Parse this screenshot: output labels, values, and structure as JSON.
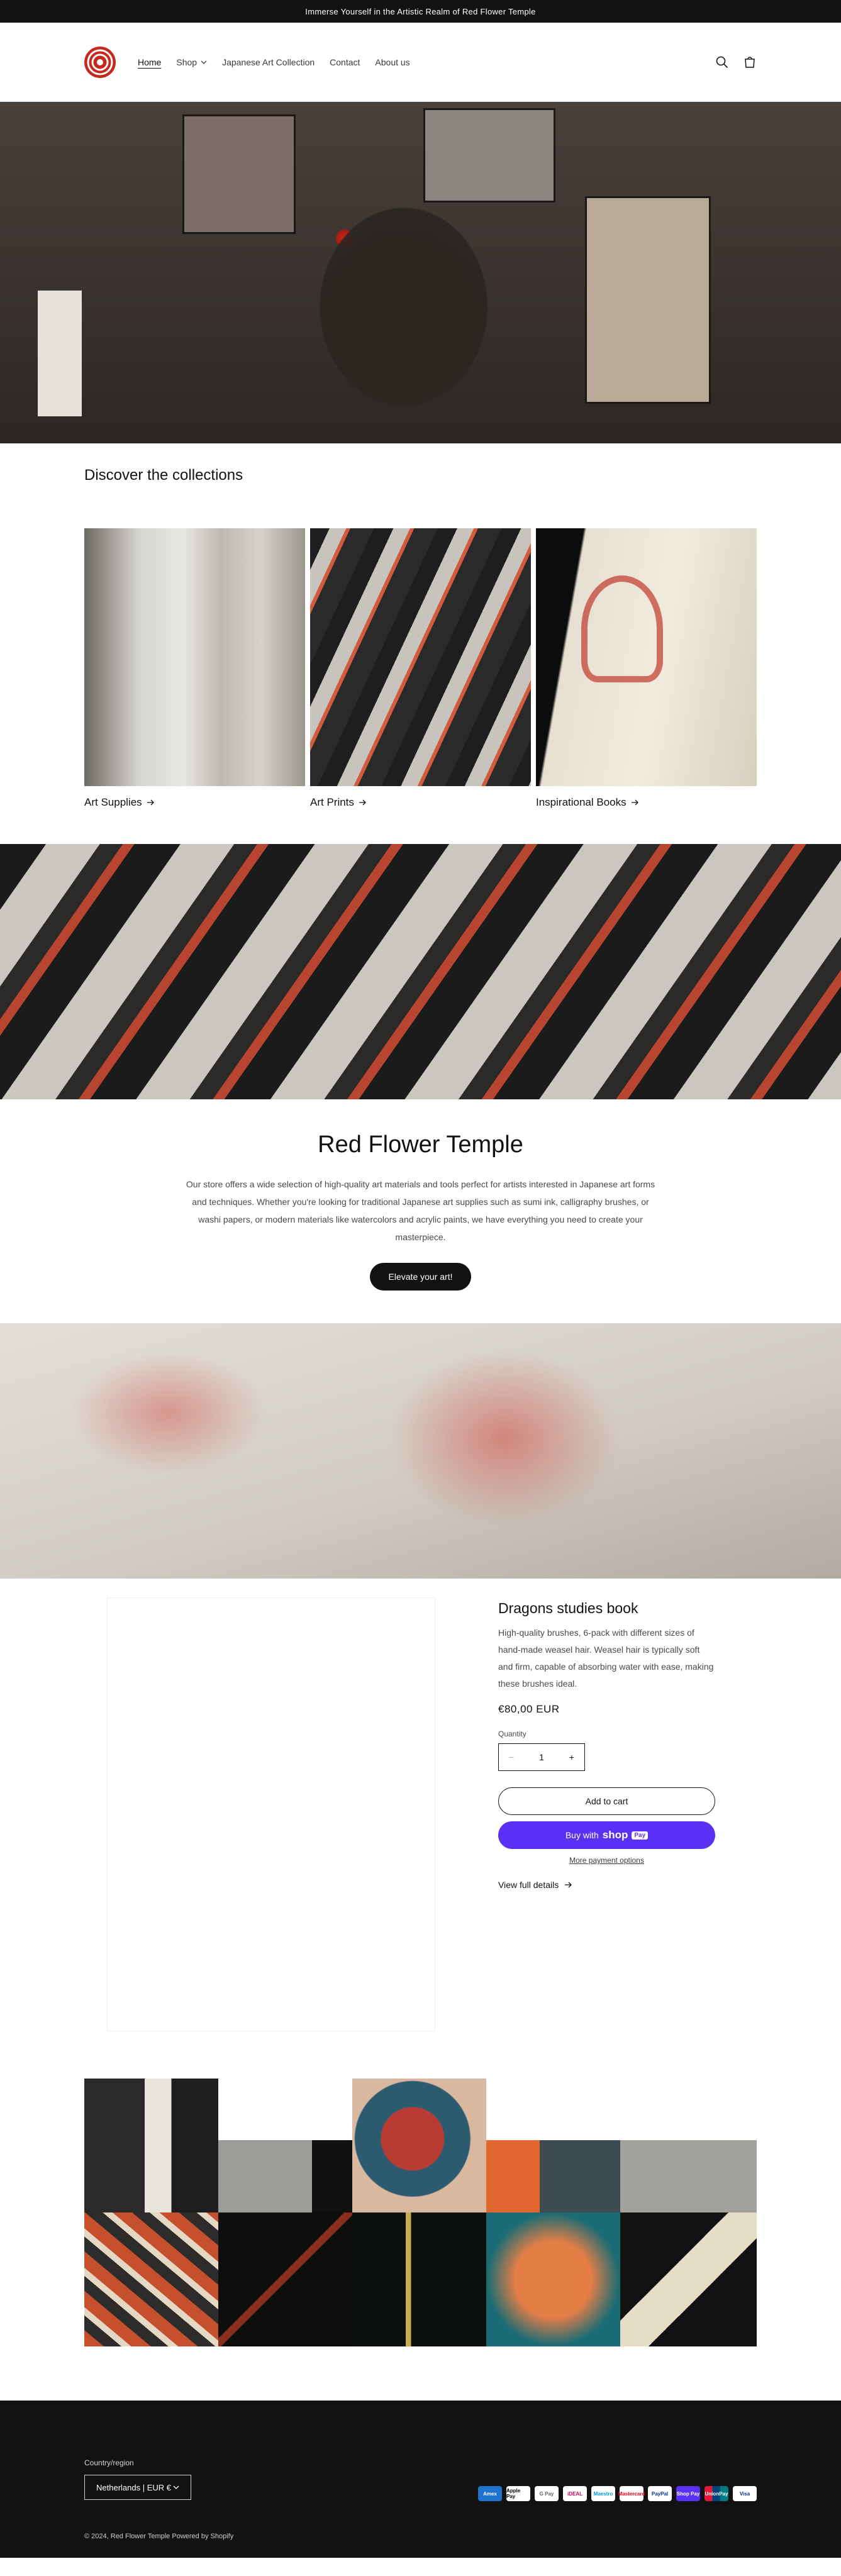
{
  "announcement": "Immerse Yourself in the Artistic Realm of Red Flower Temple",
  "header": {
    "nav": [
      {
        "label": "Home",
        "active": true
      },
      {
        "label": "Shop",
        "dropdown": true
      },
      {
        "label": "Japanese Art Collection"
      },
      {
        "label": "Contact"
      },
      {
        "label": "About us"
      }
    ],
    "icons": [
      "search-icon",
      "cart-icon"
    ]
  },
  "collections": {
    "title": "Discover the collections",
    "items": [
      {
        "label": "Art Supplies"
      },
      {
        "label": "Art Prints"
      },
      {
        "label": "Inspirational Books"
      }
    ]
  },
  "rich_text": {
    "heading": "Red Flower Temple",
    "body": "Our store offers a wide selection of high-quality art materials and tools perfect for artists interested in Japanese art forms and techniques. Whether you're looking for traditional Japanese art supplies such as sumi ink, calligraphy brushes, or washi papers, or modern materials like watercolors and acrylic paints, we have everything you need to create your masterpiece.",
    "button": "Elevate your art!"
  },
  "product": {
    "title": "Dragons studies book",
    "description": "High-quality brushes, 6-pack with different sizes of hand-made weasel hair. Weasel hair is typically soft and firm, capable of absorbing water with ease, making these brushes ideal.",
    "price": "€80,00 EUR",
    "quantity_label": "Quantity",
    "quantity": "1",
    "add_to_cart": "Add to cart",
    "buy_with": "Buy with",
    "shop_pay": "shop",
    "pay_tag": "Pay",
    "more_options": "More payment options",
    "view_full": "View full details"
  },
  "footer": {
    "country_label": "Country/region",
    "country_value": "Netherlands | EUR €",
    "payment_icons": [
      "Amex",
      "Apple Pay",
      "G Pay",
      "iDEAL",
      "Maestro",
      "Mastercard",
      "PayPal",
      "Shop Pay",
      "UnionPay",
      "Visa"
    ],
    "copyright": "© 2024, Red Flower Temple Powered by Shopify"
  },
  "colors": {
    "accent": "#c5281c",
    "shop_pay": "#5a31f4",
    "dark": "#121212"
  }
}
